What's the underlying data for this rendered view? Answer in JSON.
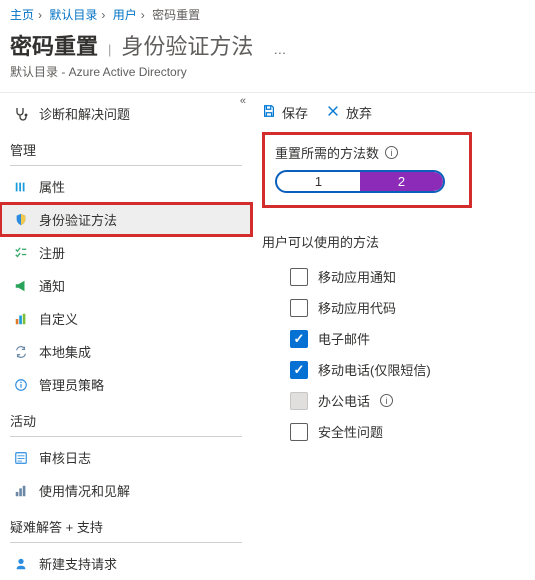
{
  "breadcrumb": {
    "items": [
      "主页",
      "默认目录",
      "用户",
      "密码重置"
    ]
  },
  "header": {
    "title_main": "密码重置",
    "title_sub": "身份验证方法",
    "subtitle": "默认目录 - Azure Active Directory"
  },
  "sidebar": {
    "diagnose": "诊断和解决问题",
    "section_manage": "管理",
    "items_manage": [
      "属性",
      "身份验证方法",
      "注册",
      "通知",
      "自定义",
      "本地集成",
      "管理员策略"
    ],
    "section_activity": "活动",
    "items_activity": [
      "审核日志",
      "使用情况和见解"
    ],
    "section_support": "疑难解答 + 支持",
    "items_support": [
      "新建支持请求"
    ]
  },
  "toolbar": {
    "save": "保存",
    "discard": "放弃"
  },
  "methods": {
    "label": "重置所需的方法数",
    "option1": "1",
    "option2": "2"
  },
  "available": {
    "label": "用户可以使用的方法",
    "opts": {
      "push": "移动应用通知",
      "code": "移动应用代码",
      "email": "电子邮件",
      "mobile": "移动电话(仅限短信)",
      "office": "办公电话",
      "security": "安全性问题"
    }
  }
}
